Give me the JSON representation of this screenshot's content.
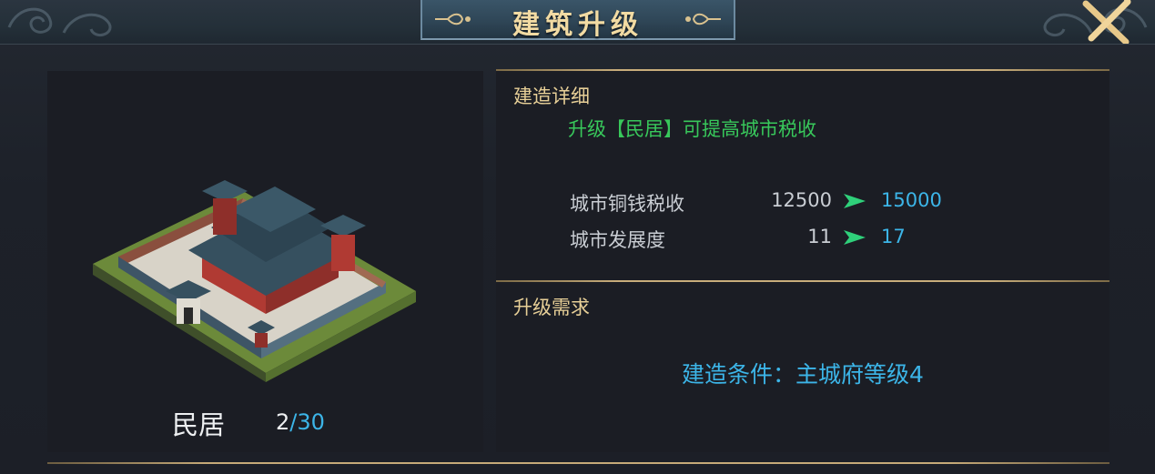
{
  "dialog": {
    "title": "建筑升级"
  },
  "building": {
    "name": "民居",
    "level_current": "2",
    "level_separator": "/",
    "level_max": "30"
  },
  "details": {
    "heading": "建造详细",
    "description": "升级【民居】可提高城市税收",
    "stats": [
      {
        "label": "城市铜钱税收",
        "old": "12500",
        "new": "15000"
      },
      {
        "label": "城市发展度",
        "old": "11",
        "new": "17"
      }
    ]
  },
  "requirements": {
    "heading": "升级需求",
    "condition": "建造条件：主城府等级4"
  },
  "colors": {
    "accent_gold": "#e7cf97",
    "value_blue": "#3cb5e8",
    "description_green": "#38c85b",
    "arrow_green": "#2fd07a"
  },
  "icons": {
    "close": "close-x-icon",
    "arrow": "right-arrow-icon"
  }
}
